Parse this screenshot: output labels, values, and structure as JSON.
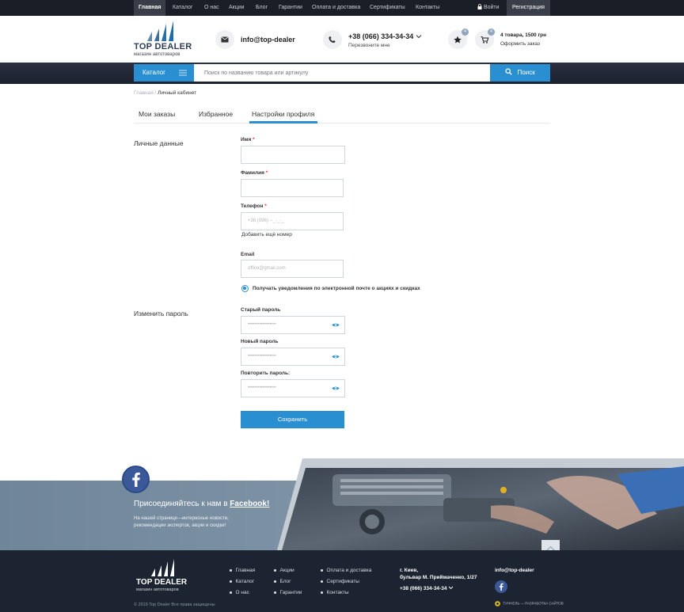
{
  "topnav": {
    "items": [
      "Главная",
      "Каталог",
      "О нас",
      "Акции",
      "Блог",
      "Гарантии",
      "Оплата и доставка",
      "Сертификаты",
      "Контакты"
    ],
    "login": "Войти",
    "register": "Регистрация"
  },
  "header": {
    "logo_name": "TOP DEALER",
    "logo_tagline": "магазин автотоваров",
    "email": "info@top-dealer",
    "phone": "+38 (066) 334-34-34",
    "callback": "Перезвоните мне",
    "fav_count": "4",
    "cart_count": "4",
    "cart_summary": "4 товара, 1500 грн",
    "checkout": "Оформить заказ"
  },
  "search": {
    "catalog_label": "Каталог",
    "placeholder": "Поиск по названию товара или артикулу",
    "button": "Поиск"
  },
  "breadcrumb": {
    "home": "Главная",
    "sep": " / ",
    "current": "Личный кабинет"
  },
  "tabs": [
    "Мои заказы",
    "Избранное",
    "Настройки профиля"
  ],
  "form": {
    "personal_title": "Личные данные",
    "first_name_label": "Имя",
    "last_name_label": "Фамилия",
    "phone_label": "Телефон",
    "phone_placeholder": "+38 (096) --_-_-_",
    "add_phone": "Добавить ещё номер",
    "email_label": "Email",
    "email_placeholder": "office@gmail.com",
    "notify_label": "Получать уведомления по электронной почте о акциях и скидках",
    "password_title": "Изменить пароль",
    "old_password_label": "Старый пароль",
    "new_password_label": "Новый пароль",
    "repeat_password_label": "Повторить пароль:",
    "password_mask": "•••••••••••••••••",
    "save": "Сохранить"
  },
  "promo": {
    "title_prefix": "Присоединяйтесь к нам в ",
    "title_link": "Facebook!",
    "text_line1": "На нашей странице—интересные новости,",
    "text_line2": "рекомендации экспертов, акции и скидки!"
  },
  "footer": {
    "col1": [
      "Главная",
      "Каталог",
      "О нас"
    ],
    "col2": [
      "Акции",
      "Блог",
      "Гарантии"
    ],
    "col3": [
      "Оплата и доставка",
      "Сертификаты",
      "Контакты"
    ],
    "city": "г. Киев,",
    "address": "бульвар М. Приймаченко, 1/27",
    "phone": "+38 (066) 334-34-34",
    "email": "info@top-dealer",
    "copyright": "© 2019 Top Dealer Все права защищены",
    "dev_credit": "ТУННЕЛЬ — РАЗРАБОТКА САЙТОВ"
  },
  "colors": {
    "accent": "#2a8fd0",
    "dark": "#1b1e26",
    "footer": "#1b2430",
    "facebook": "#3b5998"
  }
}
